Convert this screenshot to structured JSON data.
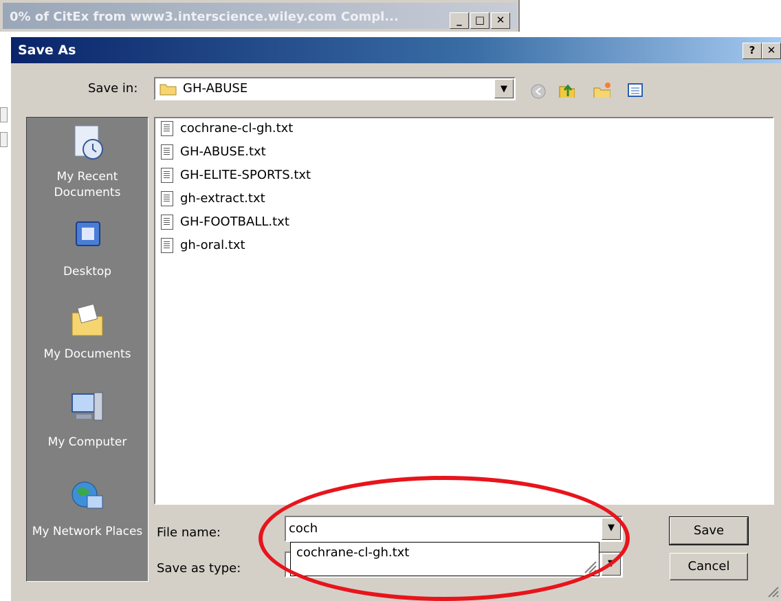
{
  "background_window": {
    "title": "0% of CitEx from www3.interscience.wiley.com Compl..."
  },
  "dialog": {
    "title": "Save As",
    "help_button": "?",
    "close_button": "X"
  },
  "save_in": {
    "label": "Save in:",
    "value": "GH-ABUSE"
  },
  "places": [
    {
      "label": "My Recent Documents",
      "icon": "recent-documents-icon"
    },
    {
      "label": "Desktop",
      "icon": "desktop-icon"
    },
    {
      "label": "My Documents",
      "icon": "my-documents-icon"
    },
    {
      "label": "My Computer",
      "icon": "my-computer-icon"
    },
    {
      "label": "My Network Places",
      "icon": "network-places-icon"
    }
  ],
  "files": [
    "cochrane-cl-gh.txt",
    "GH-ABUSE.txt",
    "GH-ELITE-SPORTS.txt",
    "gh-extract.txt",
    "GH-FOOTBALL.txt",
    "gh-oral.txt"
  ],
  "file_name": {
    "label": "File name:",
    "value": "coch",
    "suggestion": "cochrane-cl-gh.txt"
  },
  "save_as_type": {
    "label": "Save as type:"
  },
  "buttons": {
    "save": "Save",
    "cancel": "Cancel"
  },
  "colors": {
    "title_bar": "#0a246a",
    "dialog_face": "#d4d0c8",
    "annotation_circle": "#e8141c"
  }
}
